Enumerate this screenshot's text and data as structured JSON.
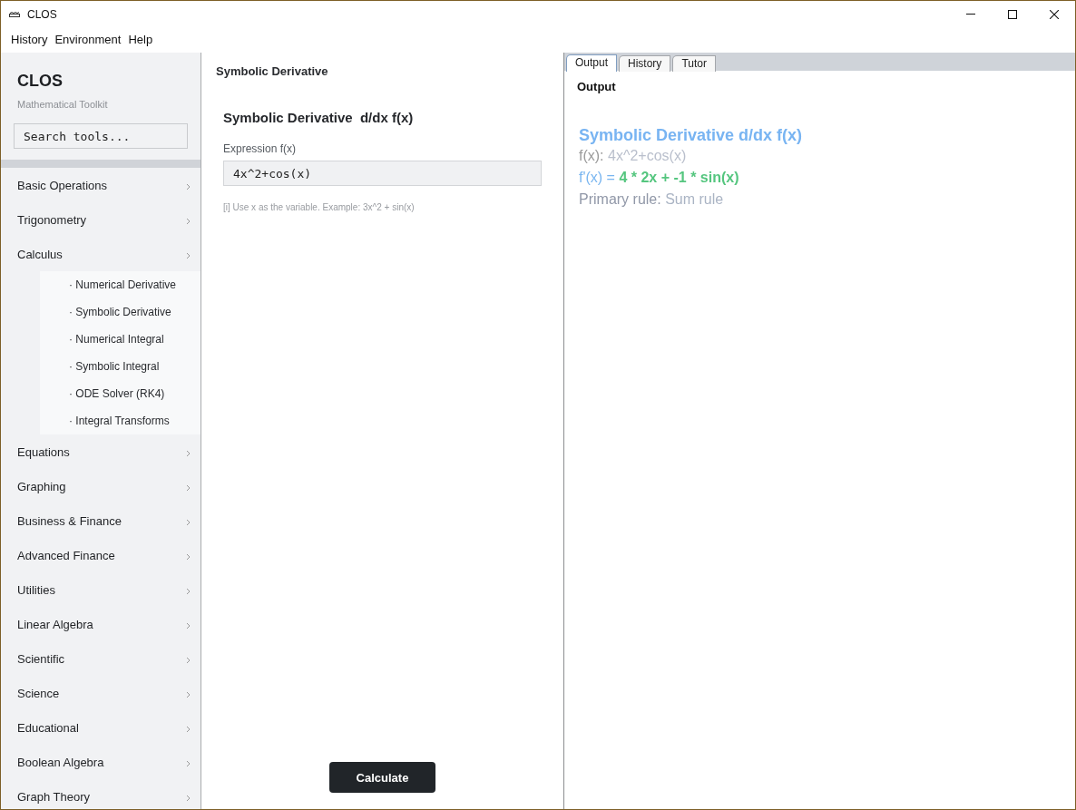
{
  "window": {
    "title": "CLOS"
  },
  "menu": [
    "History",
    "Environment",
    "Help"
  ],
  "sidebar": {
    "brand": "CLOS",
    "subtitle": "Mathematical Toolkit",
    "search": {
      "placeholder": "Search tools..."
    },
    "categories": [
      {
        "label": "Basic Operations"
      },
      {
        "label": "Trigonometry"
      },
      {
        "label": "Calculus",
        "children": [
          {
            "label": "· Numerical Derivative"
          },
          {
            "label": "· Symbolic Derivative"
          },
          {
            "label": "· Numerical Integral"
          },
          {
            "label": "· Symbolic Integral"
          },
          {
            "label": "· ODE Solver (RK4)"
          },
          {
            "label": "· Integral Transforms"
          }
        ]
      },
      {
        "label": "Equations"
      },
      {
        "label": "Graphing"
      },
      {
        "label": "Business & Finance"
      },
      {
        "label": "Advanced Finance"
      },
      {
        "label": "Utilities"
      },
      {
        "label": "Linear Algebra"
      },
      {
        "label": "Scientific"
      },
      {
        "label": "Science"
      },
      {
        "label": "Educational"
      },
      {
        "label": "Boolean Algebra"
      },
      {
        "label": "Graph Theory"
      }
    ]
  },
  "tool_panel": {
    "heading": "Symbolic Derivative",
    "title": "Symbolic Derivative  d/dx f(x)",
    "field": {
      "label": "Expression f(x)",
      "value": "4x^2+cos(x)"
    },
    "hint": "[i] Use x as the variable. Example: 3x^2 + sin(x)",
    "button": "Calculate"
  },
  "output_panel": {
    "tabs": [
      {
        "label": "Output",
        "selected": true
      },
      {
        "label": "History",
        "selected": false
      },
      {
        "label": "Tutor",
        "selected": false
      }
    ],
    "heading": "Output",
    "result": {
      "title": "Symbolic Derivative d/dx f(x)",
      "lines": [
        {
          "kind": "input",
          "label": "f(x):",
          "value": "4x^2+cos(x)"
        },
        {
          "kind": "answer",
          "label": "f'(x) =",
          "value": "4 * 2x + -1 * sin(x)"
        },
        {
          "kind": "rule",
          "label": "Primary rule:",
          "value": "Sum rule"
        }
      ]
    }
  }
}
